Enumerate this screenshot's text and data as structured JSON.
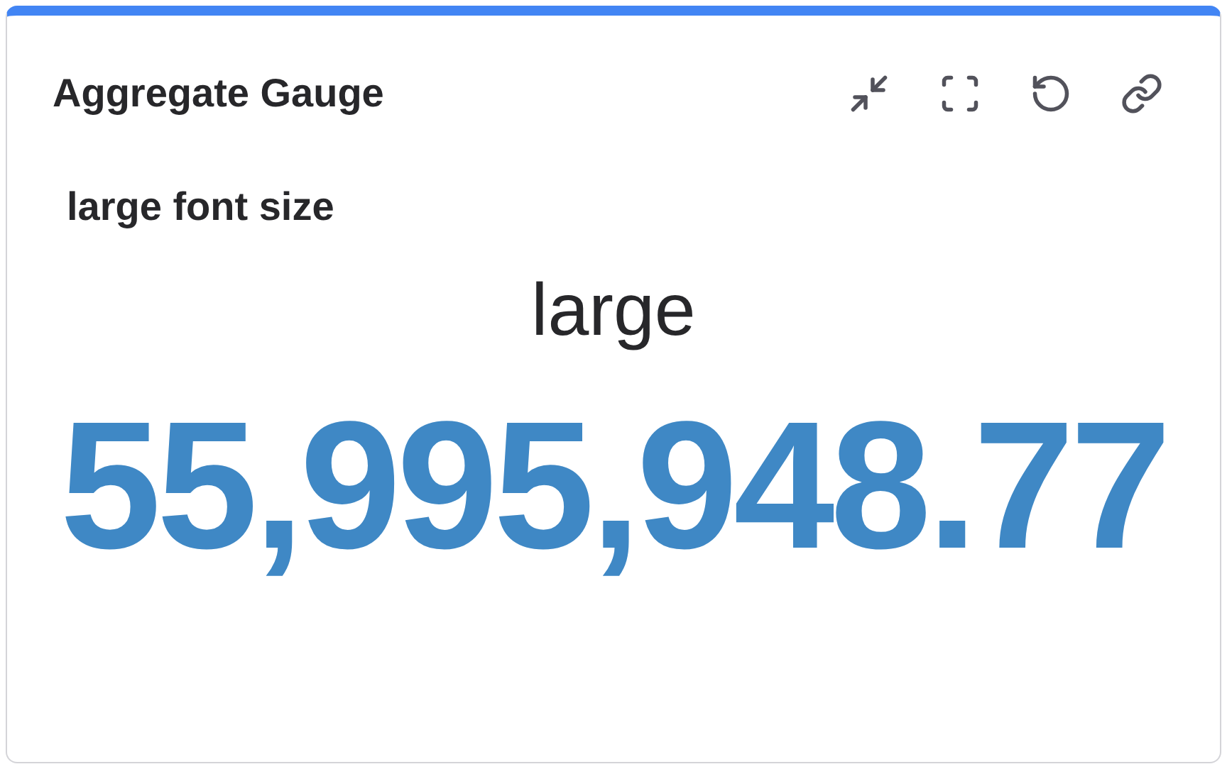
{
  "card": {
    "title": "Aggregate Gauge",
    "subtitle": "large font size",
    "size_label": "large",
    "value": "55,995,948.77"
  }
}
